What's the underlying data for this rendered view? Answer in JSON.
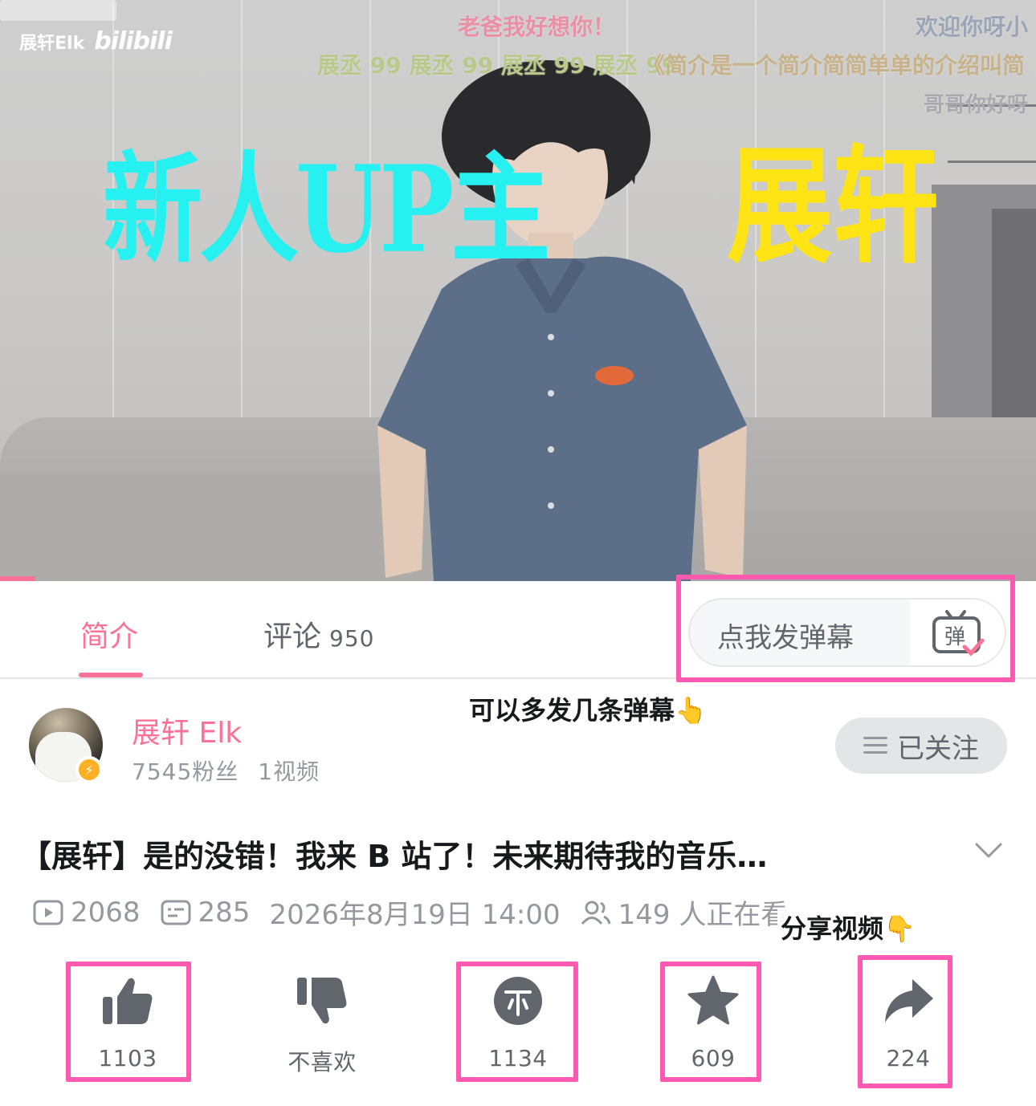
{
  "video": {
    "watermark_user": "展轩Elk",
    "watermark_brand": "bilibili",
    "danmaku": [
      "老爸我好想你！",
      "欢迎你呀小",
      "展丞 99 展丞 99 展丞 99 展丞 99",
      "《简介是一个简介简简单单的介绍叫简",
      "哥哥你好呀"
    ],
    "caption_left": "新人UP主",
    "caption_right": "展轩"
  },
  "tabs": {
    "intro_label": "简介",
    "comments_label": "评论",
    "comments_count": "950",
    "danmaku_placeholder": "点我发弹幕",
    "danmaku_icon_char": "弹"
  },
  "uploader": {
    "name": "展轩 Elk",
    "followers": "7545粉丝",
    "videos": "1视频",
    "follow_label": "已关注"
  },
  "annotations": {
    "danmaku_hint": "可以多发几条弹幕👆",
    "share_hint": "分享视频👇"
  },
  "video_info": {
    "title": "【展轩】是的没错！我来 B 站了！未来期待我的音乐…",
    "views": "2068",
    "danmaku_count": "285",
    "publish_time": "2026年8月19日 14:00",
    "watching": "149 人正在看"
  },
  "actions": {
    "like": "1103",
    "dislike": "不喜欢",
    "coin": "1134",
    "favorite": "609",
    "share": "224"
  },
  "colors": {
    "brand_pink": "#fb7299",
    "highlight_magenta": "#ff5ab0",
    "icon_gray": "#61666d"
  }
}
